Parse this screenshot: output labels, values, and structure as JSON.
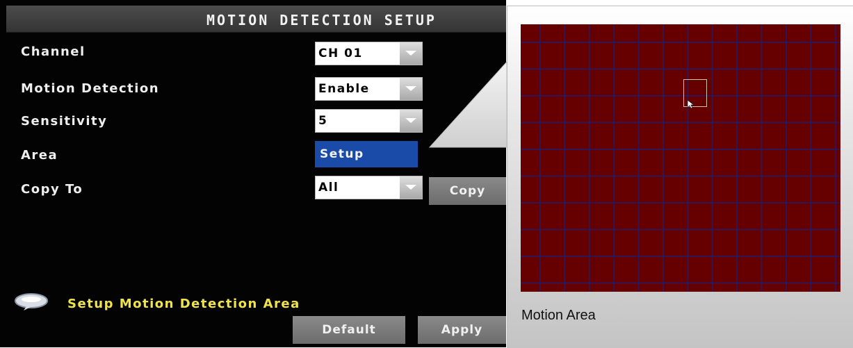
{
  "dialog": {
    "title": "MOTION DETECTION SETUP",
    "rows": {
      "channel": {
        "label": "Channel",
        "value": "CH 01"
      },
      "motion_detection": {
        "label": "Motion Detection",
        "value": "Enable"
      },
      "sensitivity": {
        "label": "Sensitivity",
        "value": "5"
      },
      "area": {
        "label": "Area",
        "button": "Setup"
      },
      "copy_to": {
        "label": "Copy To",
        "value": "All",
        "button": "Copy"
      }
    },
    "hint": "Setup Motion Detection Area",
    "footer": {
      "default_label": "Default",
      "apply_label": "Apply"
    }
  },
  "motion_area": {
    "caption": "Motion Area",
    "grid_color": "#660000",
    "line_color": "#1e1e6e"
  },
  "icons": [
    "dropdown-arrow-icon",
    "info-bubble-icon",
    "mouse-cursor-icon"
  ],
  "colors": {
    "hint_text": "#f0e44a",
    "selected_button": "#1a4ba8",
    "panel_bg": "#030303"
  }
}
